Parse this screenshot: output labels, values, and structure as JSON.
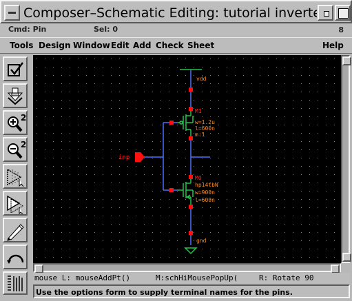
{
  "window": {
    "title": "Composer–Schematic Editing: tutorial inverter sche",
    "menu_button_icon": "window-menu-icon",
    "minimize_icon": "minimize-icon",
    "maximize_icon": "maximize-icon"
  },
  "status": {
    "cmd": "Cmd: Pin",
    "sel": "Sel: 0",
    "count": "8"
  },
  "menu": {
    "tools": "Tools",
    "design": "Design",
    "window": "Window",
    "edit": "Edit",
    "add": "Add",
    "check": "Check",
    "sheet": "Sheet",
    "help": "Help"
  },
  "toolbar": [
    {
      "name": "check-and-save-tool",
      "icon": "checkmark-icon"
    },
    {
      "name": "save-tool",
      "icon": "save-down-arrow-icon"
    },
    {
      "name": "zoom-in-tool",
      "icon": "zoom-in-icon"
    },
    {
      "name": "zoom-out-tool",
      "icon": "zoom-out-icon"
    },
    {
      "name": "stretch-tool",
      "icon": "stretch-icon"
    },
    {
      "name": "copy-tool",
      "icon": "copy-icon"
    },
    {
      "name": "wire-tool",
      "icon": "wire-pencil-icon"
    },
    {
      "name": "undo-tool",
      "icon": "undo-arc-icon"
    },
    {
      "name": "property-tool",
      "icon": "property-grid-icon"
    }
  ],
  "schematic": {
    "colors": {
      "wire": "#4f6fff",
      "pin": "#ff1010",
      "label": "#ff2020",
      "param": "#ff8a1a",
      "supply": "#22c44a",
      "device": "#22c44a",
      "grid": "#7a7a7a"
    },
    "vdd_label": "vdd",
    "gnd_label": "gnd",
    "input_label": "inp",
    "m1": {
      "name": "M1",
      "params": [
        "w=1.2u",
        "l=600n",
        "m:1"
      ]
    },
    "m0": {
      "name": "M0",
      "model": "hp14tbN",
      "params": [
        "w=900n",
        "l=600n"
      ]
    }
  },
  "mouse": {
    "left": "mouse L: mouseAddPt()",
    "middle": "M:schHiMousePopUp(",
    "right": "R: Rotate 90"
  },
  "prompt": "Use the options form to supply terminal names for the pins."
}
